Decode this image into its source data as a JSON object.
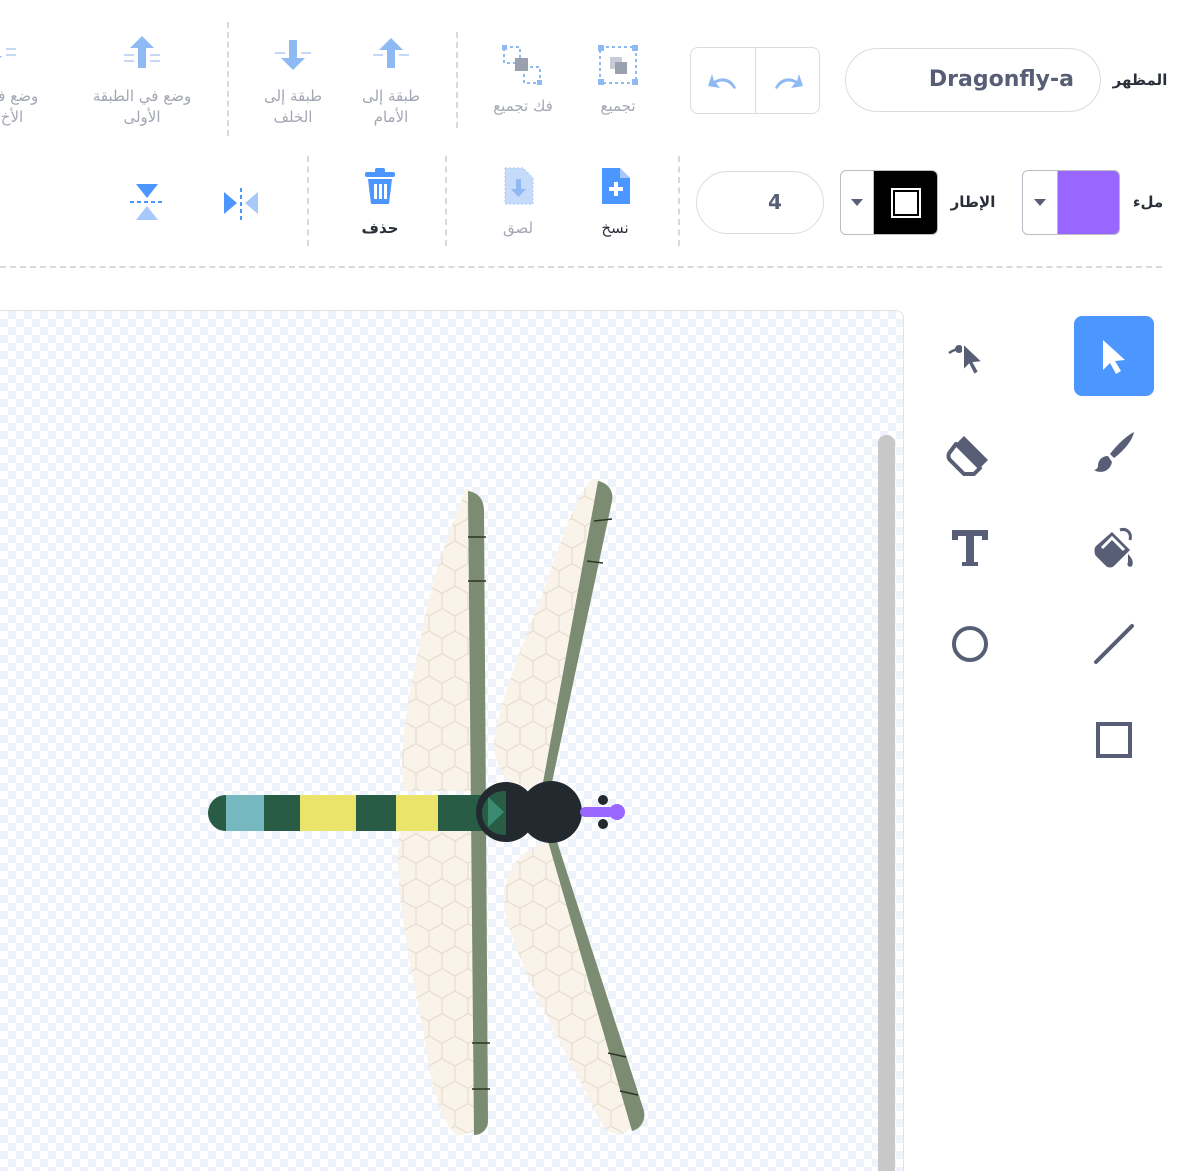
{
  "header": {
    "costume_label": "المظهر",
    "costume_name": "Dragonfly-a"
  },
  "toolbar_top": {
    "group": "تجميع",
    "ungroup": "فك تجميع",
    "forward_line1": "طبقة إلى",
    "forward_line2": "الأمام",
    "backward_line1": "طبقة إلى",
    "backward_line2": "الخلف",
    "front_line1": "وضع في الطبقة",
    "front_line2": "الأولى",
    "back_line1": "وضع في",
    "back_line2": "الأخ"
  },
  "toolbar_bottom": {
    "fill_label": "ملء",
    "outline_label": "الإطار",
    "outline_width": "4",
    "copy": "نسخ",
    "paste": "لصق",
    "delete": "حذف"
  },
  "tools": [
    "select",
    "reshape",
    "brush",
    "eraser",
    "fill",
    "text",
    "line",
    "circle",
    "rectangle"
  ],
  "colors": {
    "accent": "#4c97ff",
    "fill_color": "#9966ff",
    "outline_color": "#000000",
    "icon_gray": "#575e75"
  }
}
